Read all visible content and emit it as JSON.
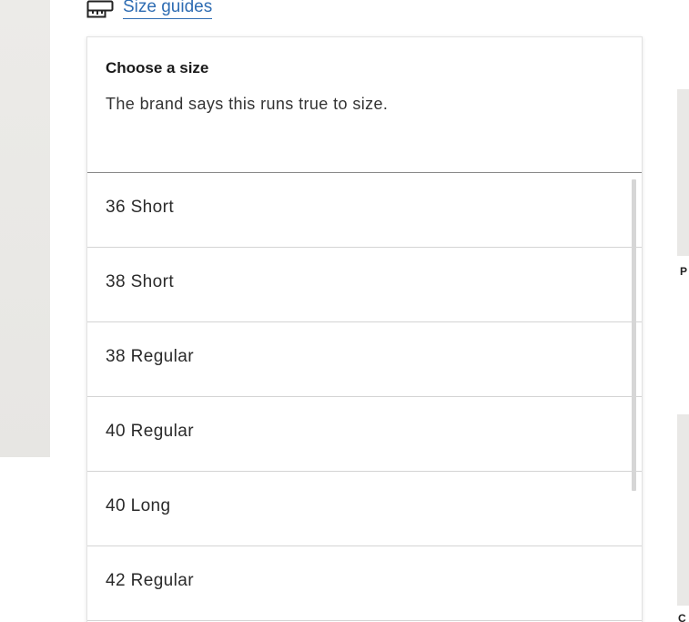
{
  "size_guide": {
    "link_text": "Size guides",
    "icon": "ruler-icon"
  },
  "size_panel": {
    "title": "Choose a size",
    "subtitle": "The brand says this runs true to size.",
    "options": [
      {
        "label": "36 Short"
      },
      {
        "label": "38 Short"
      },
      {
        "label": "38 Regular"
      },
      {
        "label": "40 Regular"
      },
      {
        "label": "40 Long"
      },
      {
        "label": "42 Regular"
      }
    ]
  },
  "right_cards": {
    "card1_label": "P",
    "card2_label": "C"
  },
  "colors": {
    "link": "#2f6db3",
    "panel_border": "#e2e2e2",
    "divider": "#d4d4d4"
  }
}
